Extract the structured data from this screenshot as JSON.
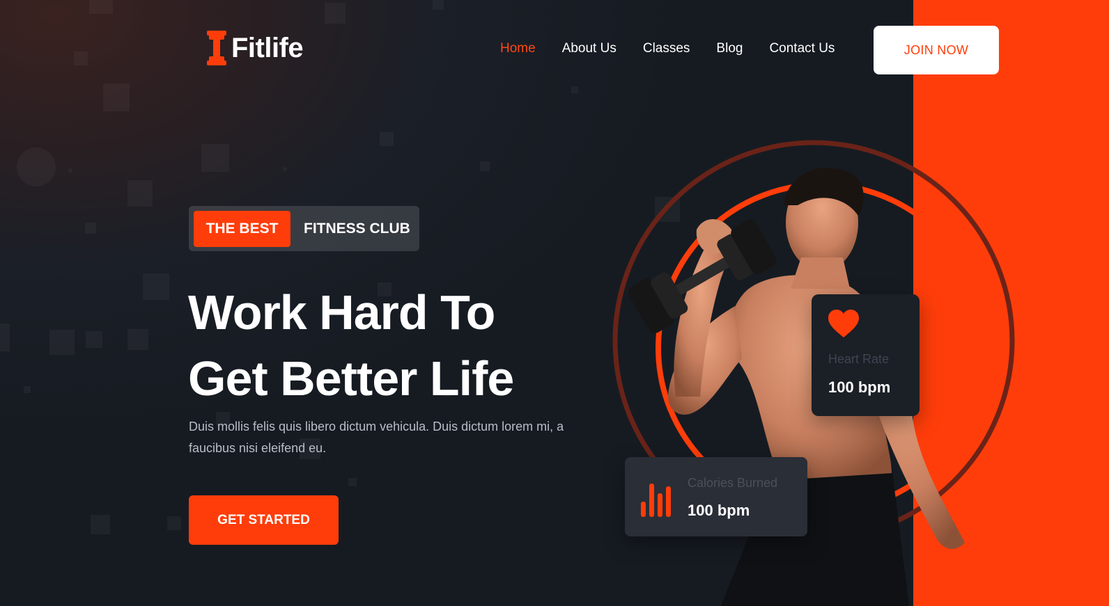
{
  "brand": {
    "name": "Fitlife",
    "accent": "#ff3d0a"
  },
  "nav": {
    "items": [
      {
        "label": "Home",
        "active": true
      },
      {
        "label": "About Us",
        "active": false
      },
      {
        "label": "Classes",
        "active": false
      },
      {
        "label": "Blog",
        "active": false
      },
      {
        "label": "Contact Us",
        "active": false
      }
    ],
    "join_label": "JOIN NOW"
  },
  "hero": {
    "badge_primary": "THE BEST",
    "badge_secondary": "FITNESS CLUB",
    "headline_line1": "Work Hard To",
    "headline_line2": "Get Better Life",
    "description": "Duis mollis felis quis libero dictum vehicula. Duis dictum lorem mi, a faucibus nisi eleifend eu.",
    "cta_label": "GET STARTED"
  },
  "stats": {
    "heart": {
      "label": "Heart Rate",
      "value": "100 bpm",
      "icon": "heart-icon"
    },
    "calories": {
      "label": "Calories Burned",
      "value": "100 bpm",
      "icon": "bar-chart-icon"
    }
  }
}
